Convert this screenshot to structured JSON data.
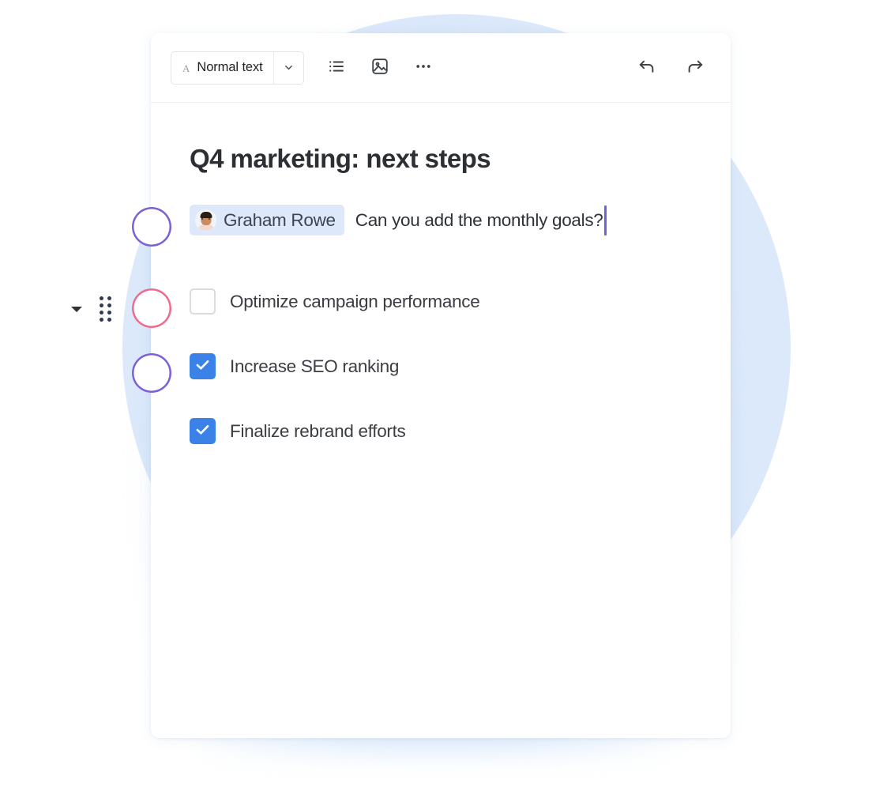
{
  "toolbar": {
    "style_selector": {
      "glyph": "A",
      "label": "Normal text",
      "caret_icon": "chevron-down-icon"
    },
    "buttons": [
      {
        "name": "bulleted-list-button",
        "icon": "bulleted-list-icon",
        "label": "Bulleted list"
      },
      {
        "name": "insert-image-button",
        "icon": "image-icon",
        "label": "Insert image"
      },
      {
        "name": "more-options-button",
        "icon": "ellipsis-icon",
        "label": "More options"
      }
    ],
    "history": [
      {
        "name": "undo-button",
        "icon": "undo-arrow-icon",
        "label": "Undo"
      },
      {
        "name": "redo-button",
        "icon": "redo-arrow-icon",
        "label": "Redo"
      }
    ]
  },
  "document": {
    "title": "Q4 marketing: next steps",
    "mention_line": {
      "mention_name": "Graham Rowe",
      "text": "Can you add the monthly goals?",
      "caret_visible": true,
      "caret_color": "#6c63d6",
      "chip_bg": "#dde8fb"
    },
    "tasks": [
      {
        "label": "Optimize campaign performance",
        "checked": false
      },
      {
        "label": "Increase SEO ranking",
        "checked": true
      },
      {
        "label": "Finalize rebrand efforts",
        "checked": true
      }
    ]
  },
  "gutter": {
    "collapse_caret_icon": "caret-down-icon",
    "drag_handle_icon": "drag-handle-dots-icon",
    "avatars": [
      {
        "name": "avatar-mention-author",
        "ring_color": "#7b61d6"
      },
      {
        "name": "avatar-task-optimize",
        "ring_color": "#ef6b8e"
      },
      {
        "name": "avatar-task-seo",
        "ring_color": "#7b61d6"
      }
    ]
  },
  "theme": {
    "accent_blue": "#3b82e8",
    "background_circle": "#cfe1fa",
    "card_bg": "#ffffff",
    "title_color": "#2c2f33"
  }
}
